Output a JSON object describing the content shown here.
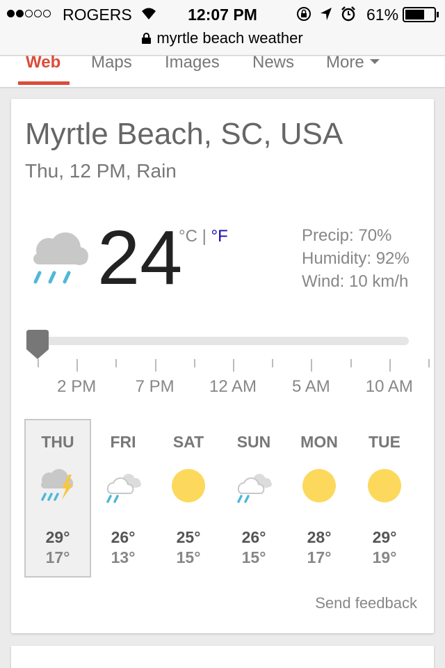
{
  "status_bar": {
    "carrier": "ROGERS",
    "time": "12:07 PM",
    "battery": "61%",
    "battery_level": 0.61
  },
  "address_bar": {
    "query": "myrtle beach weather"
  },
  "tabs": [
    {
      "label": "Web",
      "active": true
    },
    {
      "label": "Maps",
      "active": false
    },
    {
      "label": "Images",
      "active": false
    },
    {
      "label": "News",
      "active": false
    },
    {
      "label": "More",
      "active": false
    }
  ],
  "weather": {
    "location": "Myrtle Beach, SC, USA",
    "subtitle": "Thu, 12 PM, Rain",
    "temperature": "24",
    "unit_c": "°C",
    "unit_separator": "|",
    "unit_f": "°F",
    "precip": "Precip: 70%",
    "humidity": "Humidity: 92%",
    "wind": "Wind: 10 km/h",
    "current_icon": "rain-cloud-icon",
    "timeline_labels": [
      "2 PM",
      "7 PM",
      "12 AM",
      "5 AM",
      "10 AM"
    ],
    "slider_position": 0,
    "forecast": [
      {
        "day": "THU",
        "icon": "thunderstorm-icon",
        "high": "29°",
        "low": "17°",
        "selected": true
      },
      {
        "day": "FRI",
        "icon": "rain-clouds-icon",
        "high": "26°",
        "low": "13°",
        "selected": false
      },
      {
        "day": "SAT",
        "icon": "sun-icon",
        "high": "25°",
        "low": "15°",
        "selected": false
      },
      {
        "day": "SUN",
        "icon": "rain-clouds-icon",
        "high": "26°",
        "low": "15°",
        "selected": false
      },
      {
        "day": "MON",
        "icon": "sun-icon",
        "high": "28°",
        "low": "17°",
        "selected": false
      },
      {
        "day": "TUE",
        "icon": "sun-icon",
        "high": "29°",
        "low": "19°",
        "selected": false
      }
    ],
    "feedback": "Send feedback"
  },
  "colors": {
    "accent": "#dd4b39",
    "link": "#1a0dab",
    "rain": "#4eb8d9",
    "sun": "#fcd95c",
    "lightning": "#f6c744"
  }
}
